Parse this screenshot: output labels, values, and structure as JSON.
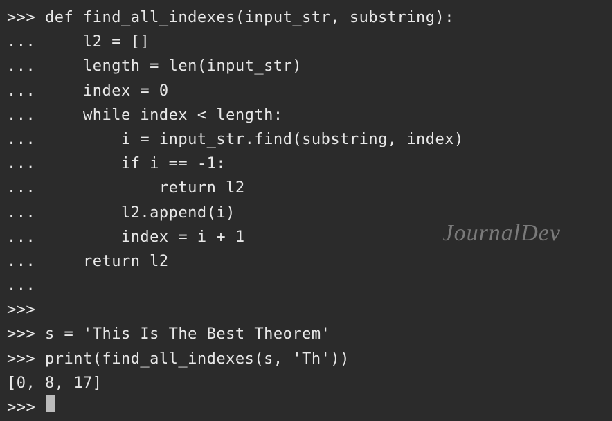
{
  "lines": [
    {
      "prompt": ">>> ",
      "code": "def find_all_indexes(input_str, substring):"
    },
    {
      "prompt": "... ",
      "code": "    l2 = []"
    },
    {
      "prompt": "... ",
      "code": "    length = len(input_str)"
    },
    {
      "prompt": "... ",
      "code": "    index = 0"
    },
    {
      "prompt": "... ",
      "code": "    while index < length:"
    },
    {
      "prompt": "... ",
      "code": "        i = input_str.find(substring, index)"
    },
    {
      "prompt": "... ",
      "code": "        if i == -1:"
    },
    {
      "prompt": "... ",
      "code": "            return l2"
    },
    {
      "prompt": "... ",
      "code": "        l2.append(i)"
    },
    {
      "prompt": "... ",
      "code": "        index = i + 1"
    },
    {
      "prompt": "... ",
      "code": "    return l2"
    },
    {
      "prompt": "... ",
      "code": ""
    },
    {
      "prompt": ">>> ",
      "code": ""
    },
    {
      "prompt": ">>> ",
      "code": "s = 'This Is The Best Theorem'"
    },
    {
      "prompt": ">>> ",
      "code": "print(find_all_indexes(s, 'Th'))"
    },
    {
      "prompt": "",
      "code": "[0, 8, 17]"
    },
    {
      "prompt": ">>> ",
      "code": "",
      "cursor": true
    }
  ],
  "watermark": "JournalDev"
}
